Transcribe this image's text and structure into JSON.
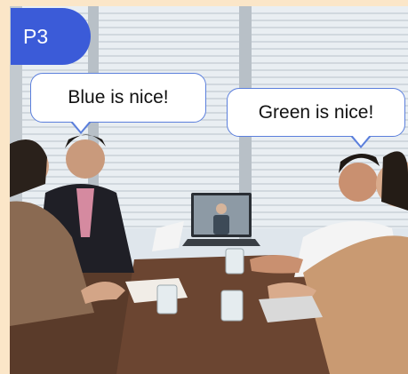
{
  "page_badge": {
    "label": "P3",
    "color": "#3b5bd8"
  },
  "speech_bubbles": {
    "left": {
      "text": "Blue is nice!"
    },
    "right": {
      "text": "Green is nice!"
    }
  },
  "colors": {
    "background": "#fbe6c8",
    "bubble_border": "#5b7fdc"
  }
}
